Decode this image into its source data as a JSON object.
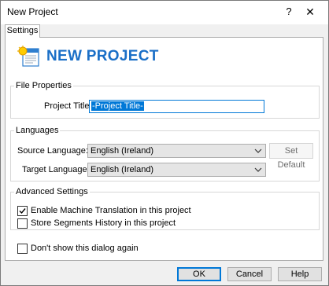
{
  "window": {
    "title": "New Project",
    "help_glyph": "?",
    "close_glyph": "✕"
  },
  "tabs": [
    {
      "label": "Settings"
    }
  ],
  "header": {
    "title": "NEW PROJECT",
    "icon": "project-document-icon"
  },
  "file_properties": {
    "legend": "File Properties",
    "project_title_label": "Project Title:",
    "project_title_value": "-Project Title-"
  },
  "languages": {
    "legend": "Languages",
    "source_label": "Source Language:",
    "source_value": "English (Ireland)",
    "target_label": "Target Language:",
    "target_value": "English (Ireland)",
    "set_default_label": "Set Default"
  },
  "advanced": {
    "legend": "Advanced Settings",
    "machine_translation_label": "Enable Machine Translation in this project",
    "machine_translation_checked": true,
    "segments_history_label": "Store Segments History in this project",
    "segments_history_checked": false
  },
  "dont_show_label": "Don't show this dialog again",
  "dont_show_checked": false,
  "buttons": {
    "ok": "OK",
    "cancel": "Cancel",
    "help": "Help"
  },
  "colors": {
    "accent": "#0078d7",
    "header_blue": "#1a6fc7",
    "dialog_bg": "#f0f0f0"
  }
}
